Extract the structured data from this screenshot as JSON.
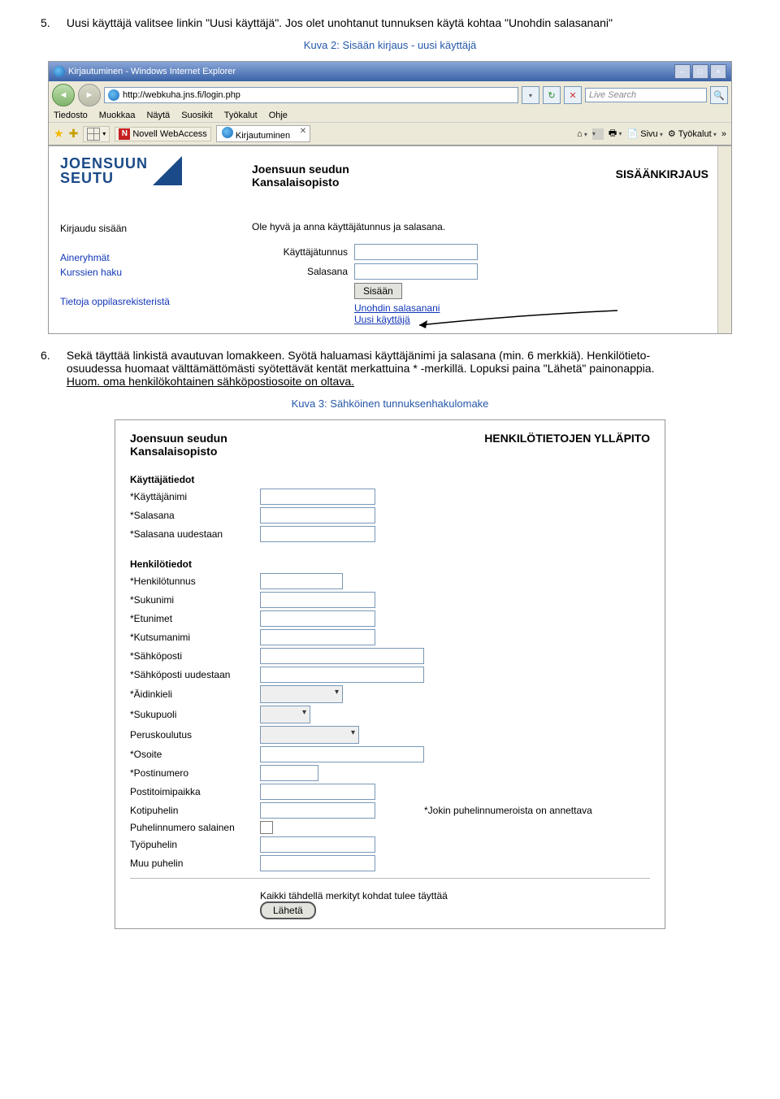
{
  "doc": {
    "item5_num": "5.",
    "item5_text": "Uusi käyttäjä valitsee linkin \"Uusi käyttäjä\". Jos olet unohtanut tunnuksen käytä kohtaa \"Unohdin salasanani\"",
    "caption2": "Kuva 2: Sisään kirjaus - uusi käyttäjä",
    "item6_num": "6.",
    "item6_text_a": "Sekä täyttää linkistä avautuvan lomakkeen. Syötä haluamasi käyttäjänimi ja salasana (min. 6 merkkiä). Henkilötieto-osuudessa huomaat välttämättömästi syötettävät kentät merkattuina * -merkillä. Lopuksi paina \"Lähetä\" painonappia. ",
    "item6_text_b": "Huom. oma henkilökohtainen sähköpostiosoite on oltava.",
    "caption3": "Kuva 3: Sähköinen tunnuksenhakulomake"
  },
  "ie": {
    "title": "Kirjautuminen - Windows Internet Explorer",
    "url": "http://webkuha.jns.fi/login.php",
    "liveSearch": "Live Search",
    "menus": [
      "Tiedosto",
      "Muokkaa",
      "Näytä",
      "Suosikit",
      "Työkalut",
      "Ohje"
    ],
    "favItem": "Novell WebAccess",
    "tabLabel": "Kirjautuminen",
    "toolbar": {
      "sivu": "Sivu",
      "tyokalut": "Työkalut"
    }
  },
  "page1": {
    "logo1": "JOENSUUN",
    "logo2": "SEUTU",
    "heading1": "Joensuun seudun",
    "heading2": "Kansalaisopisto",
    "right": "SISÄÄNKIRJAUS",
    "nav": {
      "kirjaudu": "Kirjaudu sisään",
      "ainer": "Aineryhmät",
      "kurssit": "Kurssien haku",
      "tietoja": "Tietoja oppilasrekisteristä"
    },
    "prompt": "Ole hyvä ja anna käyttäjätunnus ja salasana.",
    "lbl_user": "Käyttäjätunnus",
    "lbl_pass": "Salasana",
    "btn_login": "Sisään",
    "link_forgot": "Unohdin salasanani",
    "link_newuser": "Uusi käyttäjä"
  },
  "page2": {
    "heading1": "Joensuun seudun",
    "heading2": "Kansalaisopisto",
    "right": "HENKILÖTIETOJEN YLLÄPITO",
    "sect_user": "Käyttäjätiedot",
    "f_user": "*Käyttäjänimi",
    "f_pass": "*Salasana",
    "f_pass2": "*Salasana uudestaan",
    "sect_person": "Henkilötiedot",
    "f_hetu": "*Henkilötunnus",
    "f_ln": "*Sukunimi",
    "f_fn": "*Etunimet",
    "f_nick": "*Kutsumanimi",
    "f_email": "*Sähköposti",
    "f_email2": "*Sähköposti uudestaan",
    "f_lang": "*Äidinkieli",
    "f_sex": "*Sukupuoli",
    "f_edu": "Peruskoulutus",
    "f_addr": "*Osoite",
    "f_zip": "*Postinumero",
    "f_city": "Postitoimipaikka",
    "f_homep": "Kotipuhelin",
    "f_hidden": "Puhelinnumero salainen",
    "f_workp": "Työpuhelin",
    "f_otherp": "Muu puhelin",
    "note_phone": "*Jokin puhelinnumeroista on annettava",
    "footnote": "Kaikki tähdellä merkityt kohdat tulee täyttää",
    "btn_send": "Lähetä"
  }
}
